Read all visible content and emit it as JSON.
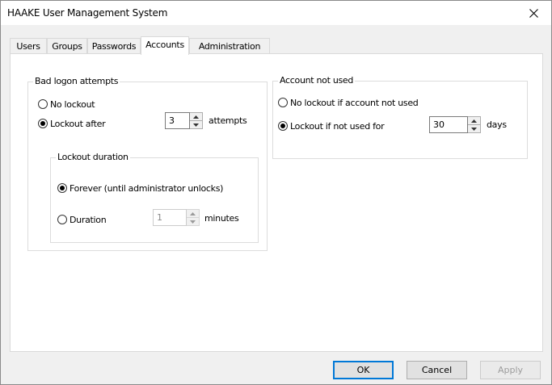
{
  "window": {
    "title": "HAAKE User Management System",
    "close_glyph": "✕"
  },
  "tabs": [
    {
      "label": "Users",
      "active": false
    },
    {
      "label": "Groups",
      "active": false
    },
    {
      "label": "Passwords",
      "active": false
    },
    {
      "label": "Accounts",
      "active": true
    },
    {
      "label": "Administration",
      "active": false
    }
  ],
  "bad_logon": {
    "legend": "Bad logon attempts",
    "no_lockout_label": "No lockout",
    "lockout_after_label": "Lockout after",
    "selected": "lockout_after",
    "attempts_value": "3",
    "attempts_unit": "attempts",
    "duration": {
      "legend": "Lockout duration",
      "forever_label": "Forever (until administrator unlocks)",
      "duration_label": "Duration",
      "selected": "forever",
      "minutes_value": "1",
      "minutes_unit": "minutes"
    }
  },
  "account_not_used": {
    "legend": "Account not used",
    "no_lockout_label": "No lockout if account not used",
    "lockout_label": "Lockout if not used for",
    "selected": "lockout",
    "days_value": "30",
    "days_unit": "days"
  },
  "buttons": {
    "ok": "OK",
    "cancel": "Cancel",
    "apply": "Apply"
  }
}
